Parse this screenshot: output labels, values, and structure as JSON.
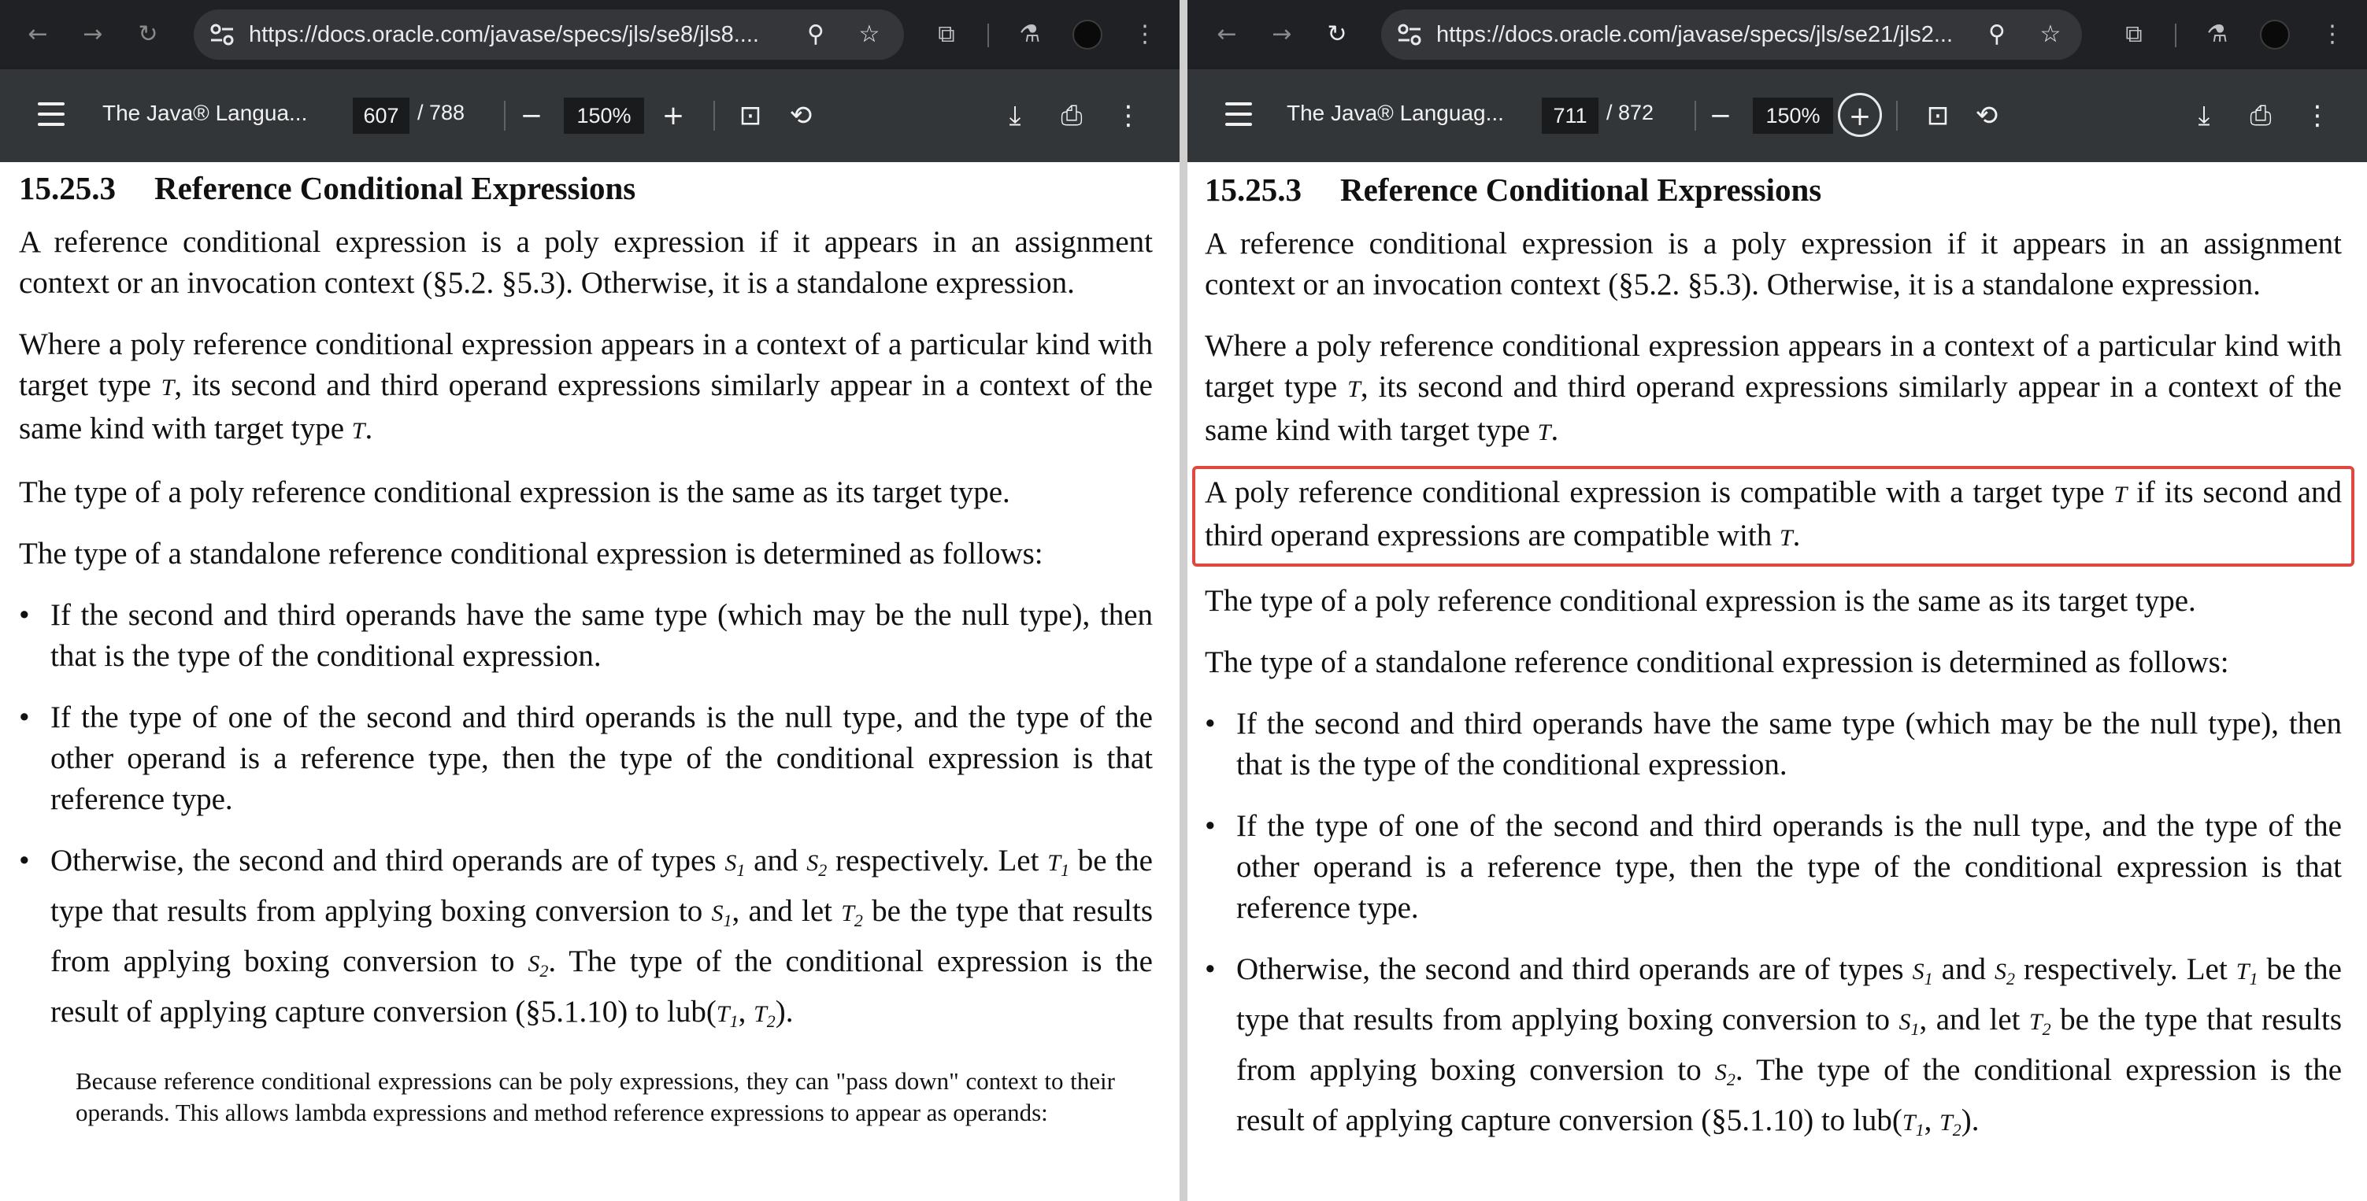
{
  "left": {
    "url": "https://docs.oracle.com/javase/specs/jls/se8/jls8....",
    "doc_title": "The Java® Langua...",
    "page_current": "607",
    "page_total": "/ 788",
    "zoom": "150%"
  },
  "right": {
    "url": "https://docs.oracle.com/javase/specs/jls/se21/jls2...",
    "doc_title": "The Java® Languag...",
    "page_current": "711",
    "page_total": "/ 872",
    "zoom": "150%"
  },
  "content": {
    "section_number": "15.25.3",
    "section_title": "Reference Conditional Expressions",
    "p1": "A reference conditional expression is a poly expression if it appears in an assignment context or an invocation context (§5.2. §5.3). Otherwise, it is a standalone expression.",
    "p2_a": "Where a poly reference conditional expression appears in a context of a particular kind with target type ",
    "p2_b": ", its second and third operand expressions similarly appear in a context of the same kind with target type ",
    "highlight_a": "A poly reference conditional expression is compatible with a target type ",
    "highlight_b": " if its second and third operand expressions are compatible with ",
    "p3": "The type of a poly reference conditional expression is the same as its target type.",
    "p4": "The type of a standalone reference conditional expression is determined as follows:",
    "b1": "If the second and third operands have the same type (which may be the null type), then that is the type of the conditional expression.",
    "b2": "If the type of one of the second and third operands is the null type, and the type of the other operand is a reference type, then the type of the conditional expression is that reference type.",
    "b3_a": "Otherwise, the second and third operands are of types ",
    "b3_and": " and ",
    "b3_b": " respectively. Let ",
    "b3_c": " be the type that results from applying boxing conversion to ",
    "b3_d": ", and let ",
    "b3_e": " be the type that results from applying boxing conversion to ",
    "b3_f": ". The type of the conditional expression is the result of applying capture conversion (§5.1.10) to lub(",
    "b3_comma": ", ",
    "b3_end": ").",
    "note": "Because reference conditional expressions can be poly expressions, they can \"pass down\" context to their operands. This allows lambda expressions and method reference expressions to appear as operands:",
    "sym_T": "T",
    "sym_S": "S",
    "sub_1": "1",
    "sub_2": "2",
    "period": "."
  }
}
